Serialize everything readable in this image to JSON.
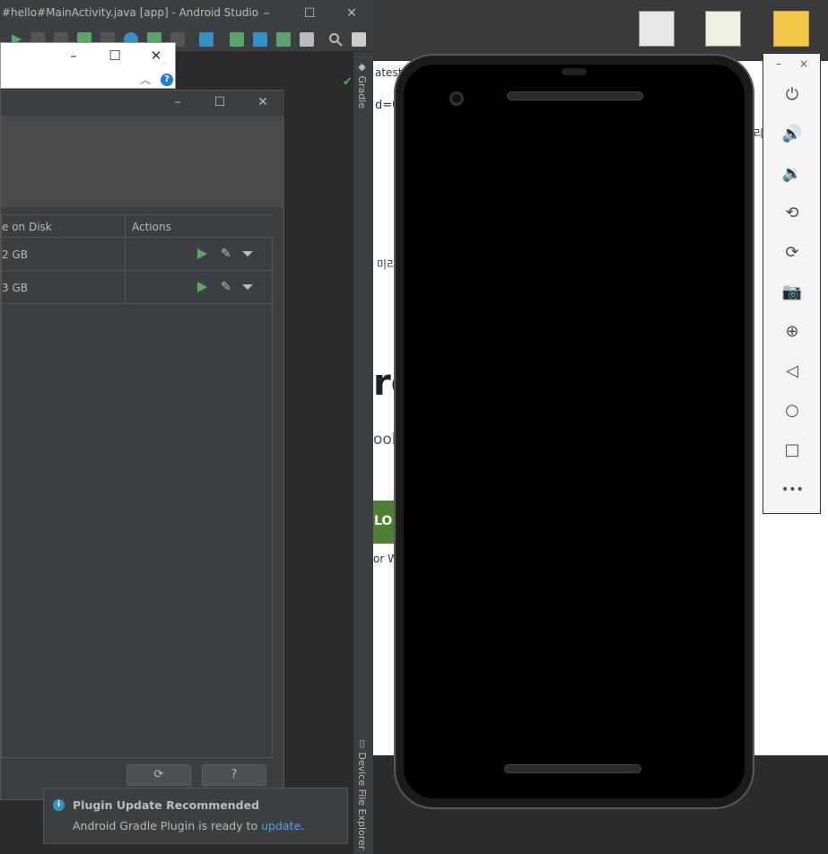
{
  "studio": {
    "title": "#hello#MainActivity.java [app] - Android Studio",
    "right_tabs": {
      "gradle": "Gradle",
      "device_file_explorer": "Device File Explorer"
    }
  },
  "avd_manager": {
    "columns": {
      "size": "e on Disk",
      "actions": "Actions"
    },
    "rows": [
      {
        "size": "2 GB"
      },
      {
        "size": "3 GB"
      }
    ],
    "buttons": {
      "refresh": "⟳",
      "help": "?"
    }
  },
  "notification": {
    "title": "Plugin Update Recommended",
    "body": "Android Gradle Plugin is ready to",
    "link": "update",
    "period": "."
  },
  "browser": {
    "fragments": [
      "atest",
      "d=0",
      "미리",
      "re",
      "ools",
      "LO",
      "or W",
      "리"
    ]
  },
  "emulator": {
    "controls": [
      "power",
      "volume-up",
      "volume-down",
      "rotate-left",
      "rotate-right",
      "screenshot",
      "zoom",
      "back",
      "home",
      "overview",
      "more"
    ],
    "close": "×",
    "minimize": "–",
    "more_label": "•••"
  },
  "colors": {
    "play": "#59a869",
    "link": "#589df6",
    "info": "#3592c4"
  }
}
